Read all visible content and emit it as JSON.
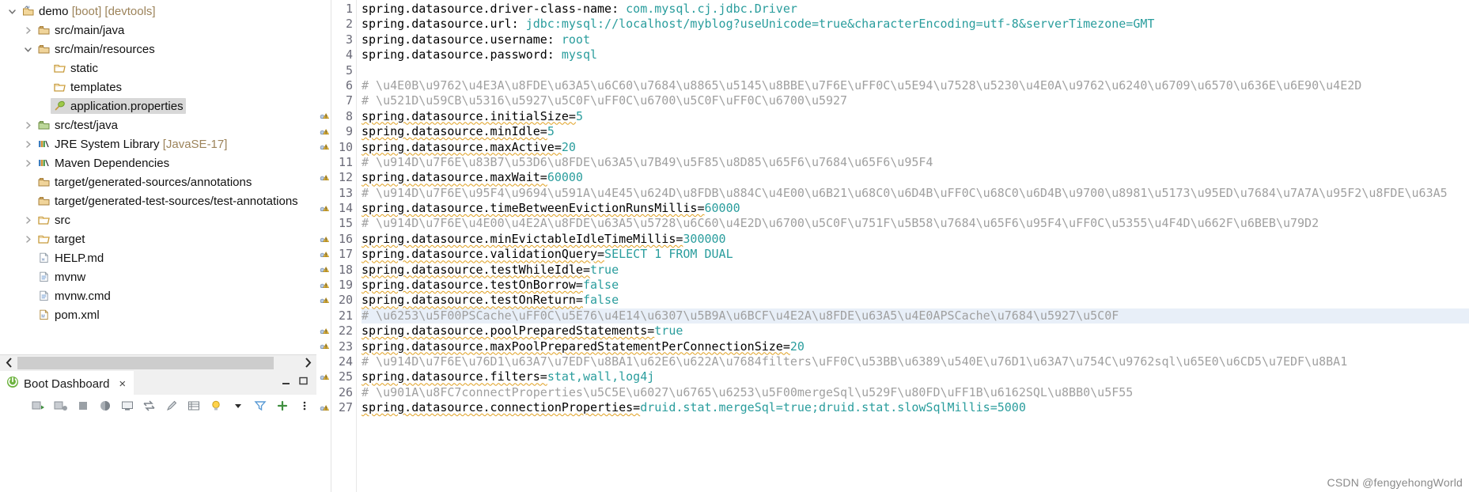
{
  "explorer": {
    "name": "package-explorer",
    "items": [
      {
        "indent": 0,
        "twisty": "down",
        "icon": "maven-project-icon",
        "label": "demo ",
        "suffix": "[boot] [devtools]",
        "selected": false
      },
      {
        "indent": 1,
        "twisty": "right",
        "icon": "source-folder-icon",
        "label": "src/main/java",
        "suffix": "",
        "selected": false
      },
      {
        "indent": 1,
        "twisty": "down",
        "icon": "source-folder-icon",
        "label": "src/main/resources",
        "suffix": "",
        "selected": false
      },
      {
        "indent": 2,
        "twisty": "none",
        "icon": "folder-icon",
        "label": "static",
        "suffix": "",
        "selected": false
      },
      {
        "indent": 2,
        "twisty": "none",
        "icon": "folder-icon",
        "label": "templates",
        "suffix": "",
        "selected": false
      },
      {
        "indent": 2,
        "twisty": "none",
        "icon": "properties-file-icon",
        "label": "application.properties",
        "suffix": "",
        "selected": true
      },
      {
        "indent": 1,
        "twisty": "right",
        "icon": "test-source-folder-icon",
        "label": "src/test/java",
        "suffix": "",
        "selected": false
      },
      {
        "indent": 1,
        "twisty": "right",
        "icon": "library-icon",
        "label": "JRE System Library ",
        "suffix": "[JavaSE-17]",
        "selected": false
      },
      {
        "indent": 1,
        "twisty": "right",
        "icon": "library-icon",
        "label": "Maven Dependencies",
        "suffix": "",
        "selected": false
      },
      {
        "indent": 1,
        "twisty": "none",
        "icon": "source-folder-icon",
        "label": "target/generated-sources/annotations",
        "suffix": "",
        "selected": false
      },
      {
        "indent": 1,
        "twisty": "none",
        "icon": "source-folder-icon",
        "label": "target/generated-test-sources/test-annotations",
        "suffix": "",
        "selected": false
      },
      {
        "indent": 1,
        "twisty": "right",
        "icon": "folder-icon",
        "label": "src",
        "suffix": "",
        "selected": false
      },
      {
        "indent": 1,
        "twisty": "right",
        "icon": "folder-icon",
        "label": "target",
        "suffix": "",
        "selected": false
      },
      {
        "indent": 1,
        "twisty": "none",
        "icon": "markdown-file-icon",
        "label": "HELP.md",
        "suffix": "",
        "selected": false
      },
      {
        "indent": 1,
        "twisty": "none",
        "icon": "text-file-icon",
        "label": "mvnw",
        "suffix": "",
        "selected": false
      },
      {
        "indent": 1,
        "twisty": "none",
        "icon": "text-file-icon",
        "label": "mvnw.cmd",
        "suffix": "",
        "selected": false
      },
      {
        "indent": 1,
        "twisty": "none",
        "icon": "maven-pom-file-icon",
        "label": "pom.xml",
        "suffix": "",
        "selected": false
      }
    ],
    "hscroll": {
      "left_arrow": "‹",
      "right_arrow": "›"
    }
  },
  "boot_dashboard": {
    "tab_label": "Boot Dashboard",
    "close_label": "×",
    "minimize_label": "—",
    "maximize_label": "□",
    "toolbar_icons": [
      "start-icon",
      "debug-icon",
      "stop-icon",
      "open-browser-icon",
      "open-console-icon",
      "redeploy-icon",
      "edit-icon",
      "properties-icon",
      "toggle-hints-icon",
      "view-menu-icon",
      "filter-icon",
      "add-icon",
      "view-options-icon"
    ]
  },
  "editor": {
    "name": "application.properties",
    "line_numbers": [
      1,
      2,
      3,
      4,
      5,
      6,
      7,
      8,
      9,
      10,
      11,
      12,
      13,
      14,
      15,
      16,
      17,
      18,
      19,
      20,
      21,
      22,
      23,
      24,
      25,
      26,
      27
    ],
    "lines": [
      {
        "n": 1,
        "marker": "",
        "type": "prop",
        "key": "spring.datasource.driver-class-name: ",
        "value": "com.mysql.cj.jdbc.Driver",
        "squiggle": false,
        "highlight": false
      },
      {
        "n": 2,
        "marker": "",
        "type": "prop",
        "key": "spring.datasource.url: ",
        "value": "jdbc:mysql://localhost/myblog?useUnicode=true&characterEncoding=utf-8&serverTimezone=GMT",
        "squiggle": false,
        "highlight": false
      },
      {
        "n": 3,
        "marker": "",
        "type": "prop",
        "key": "spring.datasource.username: ",
        "value": "root",
        "squiggle": false,
        "highlight": false
      },
      {
        "n": 4,
        "marker": "",
        "type": "prop",
        "key": "spring.datasource.password: ",
        "value": "mysql",
        "squiggle": false,
        "highlight": false
      },
      {
        "n": 5,
        "marker": "",
        "type": "blank",
        "key": "",
        "value": "",
        "squiggle": false,
        "highlight": false
      },
      {
        "n": 6,
        "marker": "",
        "type": "comment",
        "key": "# \\u4E0B\\u9762\\u4E3A\\u8FDE\\u63A5\\u6C60\\u7684\\u8865\\u5145\\u8BBE\\u7F6E\\uFF0C\\u5E94\\u7528\\u5230\\u4E0A\\u9762\\u6240\\u6709\\u6570\\u636E\\u6E90\\u4E2D",
        "value": "",
        "squiggle": false,
        "highlight": false
      },
      {
        "n": 7,
        "marker": "",
        "type": "comment",
        "key": "# \\u521D\\u59CB\\u5316\\u5927\\u5C0F\\uFF0C\\u6700\\u5C0F\\uFF0C\\u6700\\u5927",
        "value": "",
        "squiggle": false,
        "highlight": false
      },
      {
        "n": 8,
        "marker": "warning",
        "type": "prop",
        "key": "spring.datasource.initialSize=",
        "value": "5",
        "squiggle": true,
        "highlight": false
      },
      {
        "n": 9,
        "marker": "warning",
        "type": "prop",
        "key": "spring.datasource.minIdle=",
        "value": "5",
        "squiggle": true,
        "highlight": false
      },
      {
        "n": 10,
        "marker": "warning",
        "type": "prop",
        "key": "spring.datasource.maxActive=",
        "value": "20",
        "squiggle": true,
        "highlight": false
      },
      {
        "n": 11,
        "marker": "",
        "type": "comment",
        "key": "# \\u914D\\u7F6E\\u83B7\\u53D6\\u8FDE\\u63A5\\u7B49\\u5F85\\u8D85\\u65F6\\u7684\\u65F6\\u95F4",
        "value": "",
        "squiggle": false,
        "highlight": false
      },
      {
        "n": 12,
        "marker": "warning",
        "type": "prop",
        "key": "spring.datasource.maxWait=",
        "value": "60000",
        "squiggle": true,
        "highlight": false
      },
      {
        "n": 13,
        "marker": "",
        "type": "comment",
        "key": "# \\u914D\\u7F6E\\u95F4\\u9694\\u591A\\u4E45\\u624D\\u8FDB\\u884C\\u4E00\\u6B21\\u68C0\\u6D4B\\uFF0C\\u68C0\\u6D4B\\u9700\\u8981\\u5173\\u95ED\\u7684\\u7A7A\\u95F2\\u8FDE\\u63A5",
        "value": "",
        "squiggle": false,
        "highlight": false
      },
      {
        "n": 14,
        "marker": "warning",
        "type": "prop",
        "key": "spring.datasource.timeBetweenEvictionRunsMillis=",
        "value": "60000",
        "squiggle": true,
        "highlight": false
      },
      {
        "n": 15,
        "marker": "",
        "type": "comment",
        "key": "# \\u914D\\u7F6E\\u4E00\\u4E2A\\u8FDE\\u63A5\\u5728\\u6C60\\u4E2D\\u6700\\u5C0F\\u751F\\u5B58\\u7684\\u65F6\\u95F4\\uFF0C\\u5355\\u4F4D\\u662F\\u6BEB\\u79D2",
        "value": "",
        "squiggle": false,
        "highlight": false
      },
      {
        "n": 16,
        "marker": "warning",
        "type": "prop",
        "key": "spring.datasource.minEvictableIdleTimeMillis=",
        "value": "300000",
        "squiggle": true,
        "highlight": false
      },
      {
        "n": 17,
        "marker": "warning",
        "type": "prop",
        "key": "spring.datasource.validationQuery=",
        "value": "SELECT 1 FROM DUAL",
        "squiggle": true,
        "highlight": false
      },
      {
        "n": 18,
        "marker": "warning",
        "type": "prop",
        "key": "spring.datasource.testWhileIdle=",
        "value": "true",
        "squiggle": true,
        "highlight": false
      },
      {
        "n": 19,
        "marker": "warning",
        "type": "prop",
        "key": "spring.datasource.testOnBorrow=",
        "value": "false",
        "squiggle": true,
        "highlight": false
      },
      {
        "n": 20,
        "marker": "warning",
        "type": "prop",
        "key": "spring.datasource.testOnReturn=",
        "value": "false",
        "squiggle": true,
        "highlight": false
      },
      {
        "n": 21,
        "marker": "",
        "type": "comment",
        "key": "# \\u6253\\u5F00PSCache\\uFF0C\\u5E76\\u4E14\\u6307\\u5B9A\\u6BCF\\u4E2A\\u8FDE\\u63A5\\u4E0APSCache\\u7684\\u5927\\u5C0F",
        "value": "",
        "squiggle": false,
        "highlight": true
      },
      {
        "n": 22,
        "marker": "warning",
        "type": "prop",
        "key": "spring.datasource.poolPreparedStatements=",
        "value": "true",
        "squiggle": true,
        "highlight": false
      },
      {
        "n": 23,
        "marker": "warning",
        "type": "prop",
        "key": "spring.datasource.maxPoolPreparedStatementPerConnectionSize=",
        "value": "20",
        "squiggle": true,
        "highlight": false
      },
      {
        "n": 24,
        "marker": "",
        "type": "comment",
        "key": "# \\u914D\\u7F6E\\u76D1\\u63A7\\u7EDF\\u8BA1\\u62E6\\u622A\\u7684filters\\uFF0C\\u53BB\\u6389\\u540E\\u76D1\\u63A7\\u754C\\u9762sql\\u65E0\\u6CD5\\u7EDF\\u8BA1",
        "value": "",
        "squiggle": false,
        "highlight": false
      },
      {
        "n": 25,
        "marker": "warning",
        "type": "prop",
        "key": "spring.datasource.filters=",
        "value": "stat,wall,log4j",
        "squiggle": true,
        "highlight": false
      },
      {
        "n": 26,
        "marker": "",
        "type": "comment",
        "key": "# \\u901A\\u8FC7connectProperties\\u5C5E\\u6027\\u6765\\u6253\\u5F00mergeSql\\u529F\\u80FD\\uFF1B\\u6162SQL\\u8BB0\\u5F55",
        "value": "",
        "squiggle": false,
        "highlight": false
      },
      {
        "n": 27,
        "marker": "warning",
        "type": "prop",
        "key": "spring.datasource.connectionProperties=",
        "value": "druid.stat.mergeSql=true;druid.stat.slowSqlMillis=5000",
        "squiggle": true,
        "highlight": false
      }
    ]
  },
  "watermark": "CSDN @fengyehongWorld",
  "colors": {
    "value_teal": "#2a9d9d",
    "comment_gray": "#a0a0a0",
    "key_black": "#000000",
    "selection_gray": "#d8d8d8",
    "line_highlight": "#e8eff8",
    "gutter_text": "#6b6b78",
    "tree_dim": "#9c835a"
  }
}
